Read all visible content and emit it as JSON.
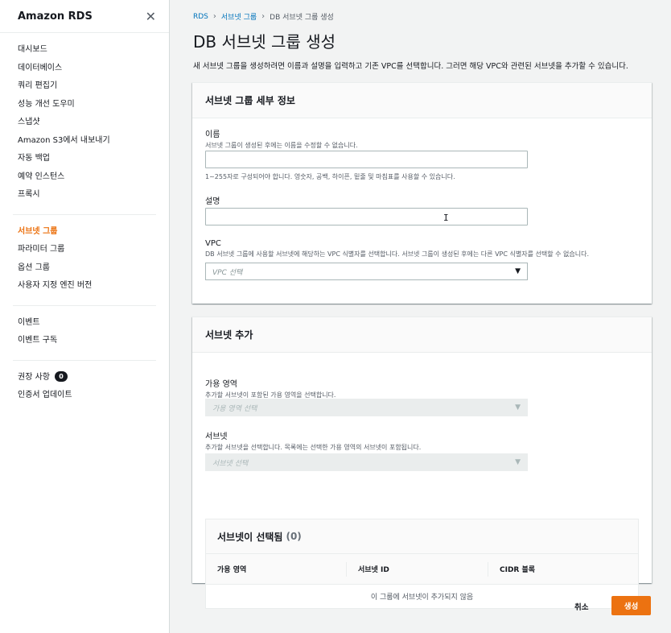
{
  "sidebar": {
    "title": "Amazon RDS",
    "close_icon": "close-icon",
    "group1": [
      "대시보드",
      "데이터베이스",
      "쿼리 편집기",
      "성능 개선 도우미",
      "스냅샷",
      "Amazon S3에서 내보내기",
      "자동 백업",
      "예약 인스턴스",
      "프록시"
    ],
    "group2": [
      "서브넷 그룹",
      "파라미터 그룹",
      "옵션 그룹",
      "사용자 지정 엔진 버전"
    ],
    "active_item": "서브넷 그룹",
    "group3": [
      "이벤트",
      "이벤트 구독"
    ],
    "recommendations_label": "권장 사항",
    "recommendations_count": "0",
    "cert_update_label": "인증서 업데이트"
  },
  "breadcrumb": {
    "rds": "RDS",
    "subnet_groups": "서브넷 그룹",
    "current": "DB 서브넷 그룹 생성"
  },
  "page": {
    "title": "DB 서브넷 그룹 생성",
    "description": "새 서브넷 그룹을 생성하려면 이름과 설명을 입력하고 기존 VPC를 선택합니다. 그러면 해당 VPC와 관련된 서브넷을 추가할 수 있습니다."
  },
  "details_panel": {
    "title": "서브넷 그룹 세부 정보",
    "name_label": "이름",
    "name_desc": "서브넷 그룹이 생성된 후에는 이름을 수정할 수 없습니다.",
    "name_value": "",
    "name_hint": "1~255자로 구성되어야 합니다. 영숫자, 공백, 하이픈, 밑줄 및 마침표를 사용할 수 있습니다.",
    "desc_label": "설명",
    "desc_value": "",
    "vpc_label": "VPC",
    "vpc_desc": "DB 서브넷 그룹에 사용할 서브넷에 해당하는 VPC 식별자를 선택합니다. 서브넷 그룹이 생성된 후에는 다른 VPC 식별자를 선택할 수 없습니다.",
    "vpc_placeholder": "VPC 선택"
  },
  "add_subnets_panel": {
    "title": "서브넷 추가",
    "az_label": "가용 영역",
    "az_desc": "추가할 서브넷이 포함된 가용 영역을 선택합니다.",
    "az_placeholder": "가용 영역 선택",
    "subnet_label": "서브넷",
    "subnet_desc": "추가할 서브넷을 선택합니다. 목록에는 선택한 가용 영역의 서브넷이 포함됩니다.",
    "subnet_placeholder": "서브넷 선택"
  },
  "selected_table": {
    "title": "서브넷이 선택됨",
    "count": "(0)",
    "columns": [
      "가용 영역",
      "서브넷 ID",
      "CIDR 블록"
    ],
    "empty_text": "이 그룹에 서브넷이 추가되지 않음"
  },
  "actions": {
    "cancel": "취소",
    "create": "생성"
  },
  "colors": {
    "accent": "#ec7211",
    "link": "#0073bb"
  }
}
